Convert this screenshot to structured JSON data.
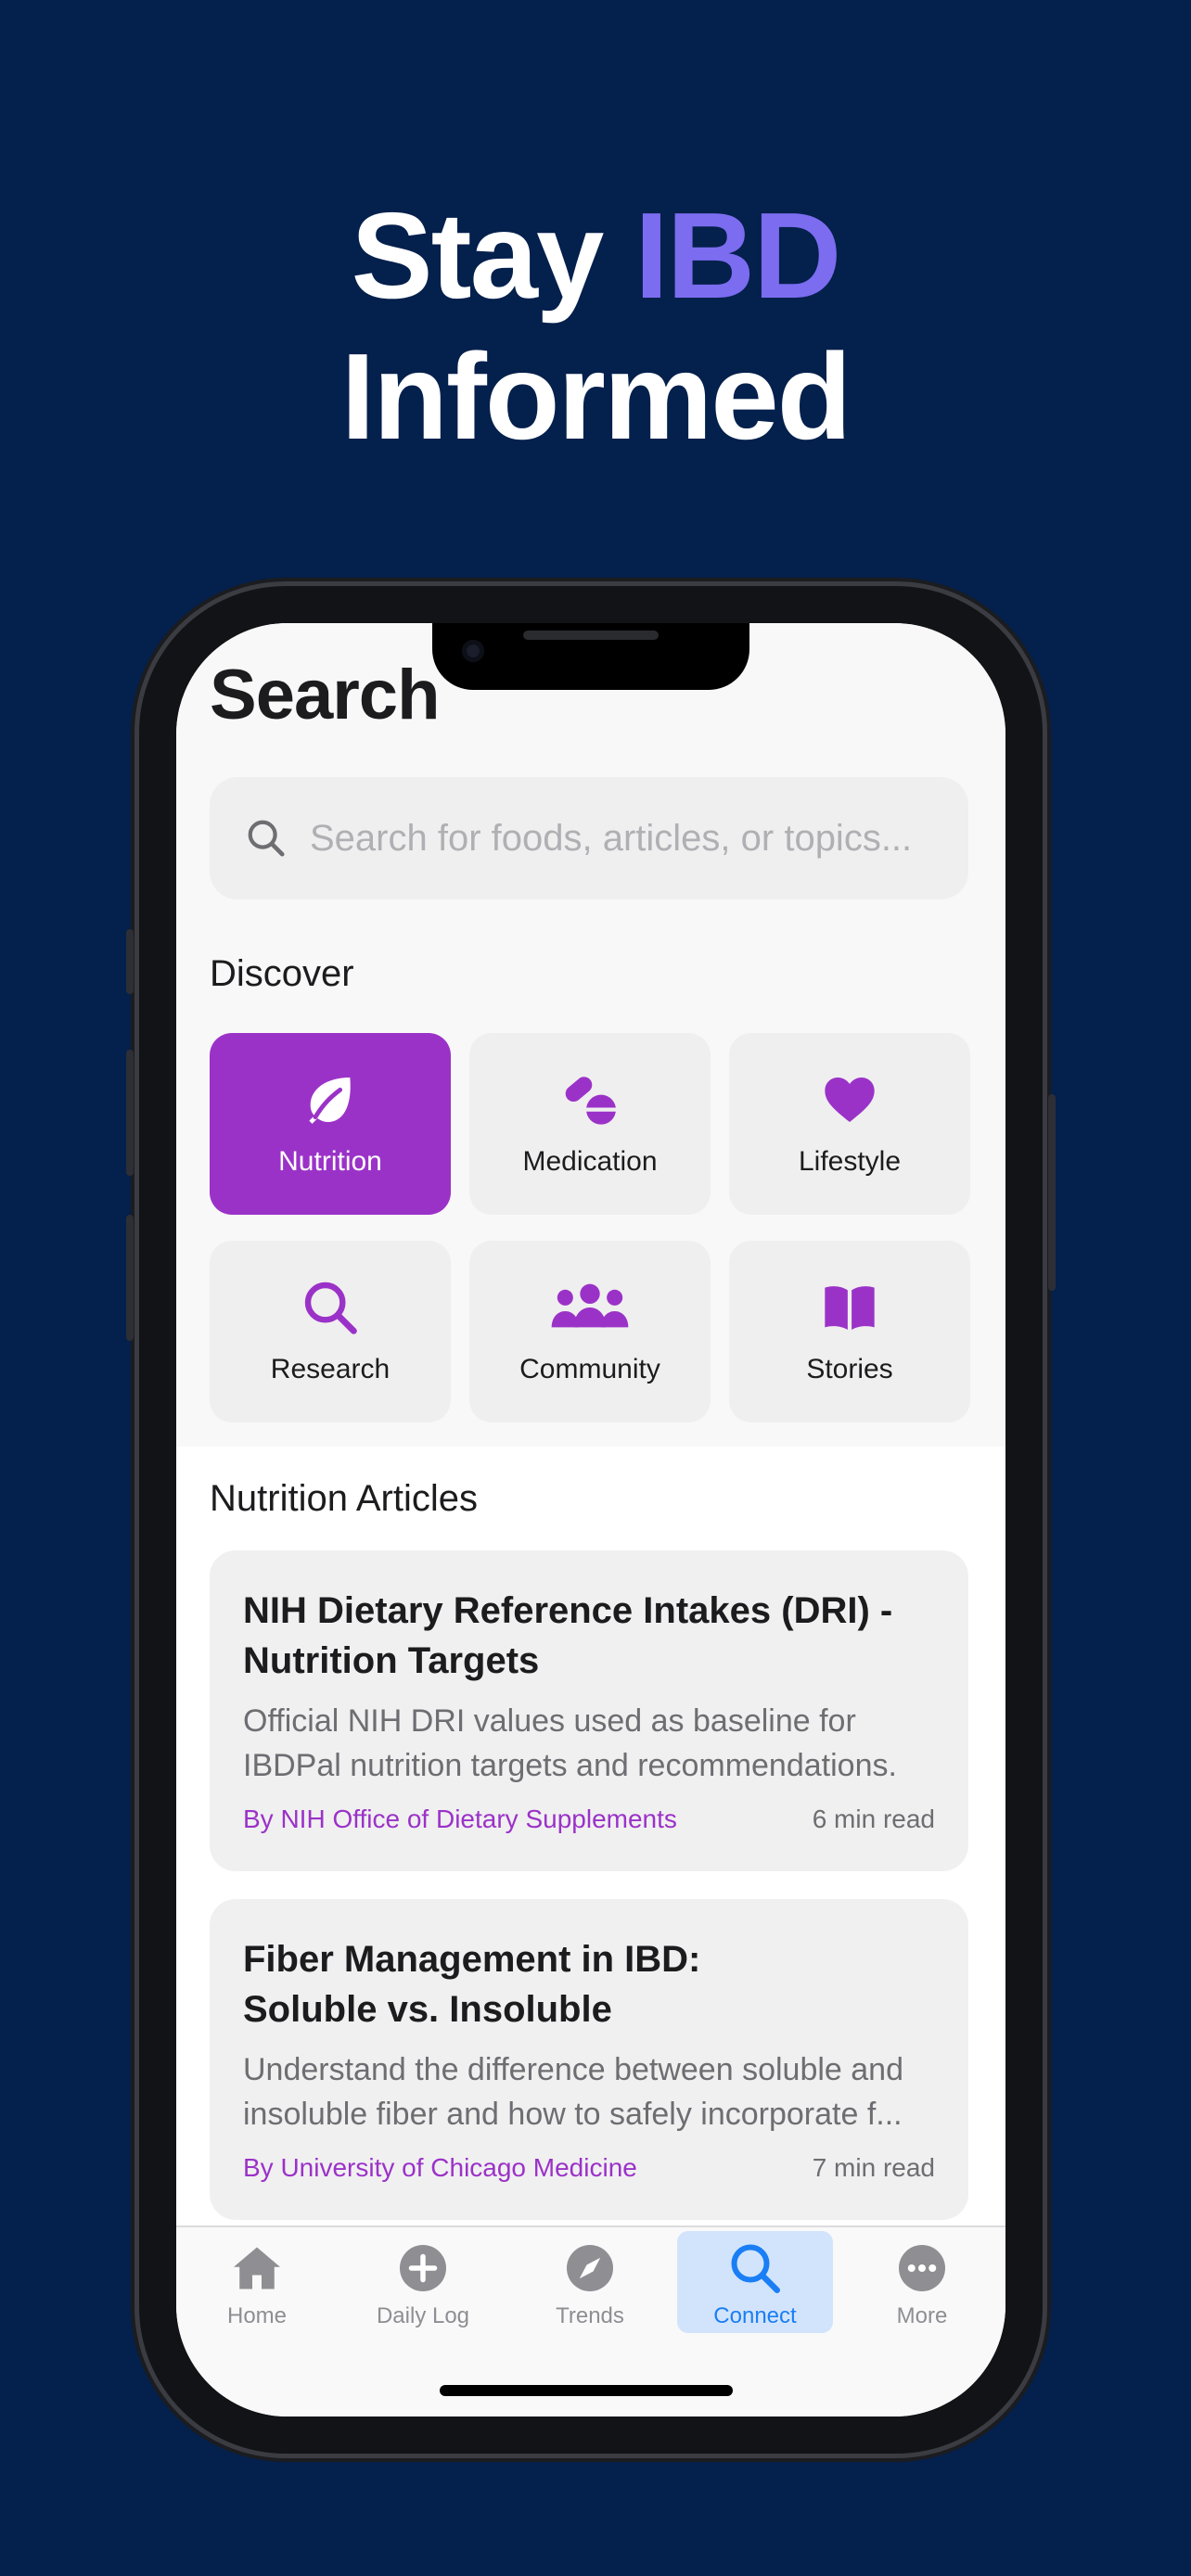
{
  "headline": {
    "word1": "Stay ",
    "accent": "IBD",
    "line2": "Informed",
    "accent_color": "#7b6cf0",
    "background": "#04204c"
  },
  "screen": {
    "title": "Search",
    "search": {
      "placeholder": "Search for foods, articles, or topics...",
      "icon": "search-icon"
    },
    "discover": {
      "title": "Discover",
      "tiles": [
        {
          "label": "Nutrition",
          "icon": "leaf-icon",
          "active": true
        },
        {
          "label": "Medication",
          "icon": "pills-icon",
          "active": false
        },
        {
          "label": "Lifestyle",
          "icon": "heart-icon",
          "active": false
        },
        {
          "label": "Research",
          "icon": "search-icon",
          "active": false
        },
        {
          "label": "Community",
          "icon": "people-icon",
          "active": false
        },
        {
          "label": "Stories",
          "icon": "book-icon",
          "active": false
        }
      ],
      "accent_color": "#9b32c8"
    },
    "articles": {
      "title": "Nutrition Articles",
      "items": [
        {
          "title": "NIH Dietary Reference Intakes (DRI) - Nutrition Targets",
          "description": "Official NIH DRI values used as baseline for IBDPal nutrition targets and recommendations.",
          "author": "By NIH Office of Dietary Supplements",
          "read_time": "6 min read"
        },
        {
          "title": "Fiber Management in IBD: Soluble vs. Insoluble",
          "description": "Understand the difference between soluble and insoluble fiber and how to safely incorporate f...",
          "author": "By University of Chicago Medicine",
          "read_time": "7 min read"
        }
      ]
    },
    "tabbar": {
      "tabs": [
        {
          "label": "Home",
          "icon": "house-icon",
          "active": false
        },
        {
          "label": "Daily Log",
          "icon": "plus-circle-icon",
          "active": false
        },
        {
          "label": "Trends",
          "icon": "compass-icon",
          "active": false
        },
        {
          "label": "Connect",
          "icon": "search-icon",
          "active": true
        },
        {
          "label": "More",
          "icon": "ellipsis-circle-icon",
          "active": false
        }
      ],
      "active_color": "#1a7ef5"
    }
  }
}
